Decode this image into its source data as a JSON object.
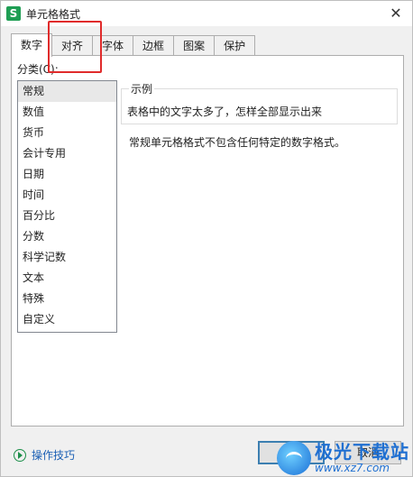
{
  "window": {
    "title": "单元格格式",
    "app_icon": "S"
  },
  "tabs": [
    {
      "label": "数字",
      "active": true
    },
    {
      "label": "对齐",
      "active": false
    },
    {
      "label": "字体",
      "active": false
    },
    {
      "label": "边框",
      "active": false
    },
    {
      "label": "图案",
      "active": false
    },
    {
      "label": "保护",
      "active": false
    }
  ],
  "category": {
    "label": "分类(C):",
    "selected": "常规",
    "items": [
      "常规",
      "数值",
      "货币",
      "会计专用",
      "日期",
      "时间",
      "百分比",
      "分数",
      "科学记数",
      "文本",
      "特殊",
      "自定义"
    ]
  },
  "sample": {
    "title": "示例",
    "text": "表格中的文字太多了，怎样全部显示出来"
  },
  "description": "常规单元格格式不包含任何特定的数字格式。",
  "footer": {
    "tips_label": "操作技巧",
    "ok_label": "确定",
    "cancel_label": "取消"
  },
  "watermark": {
    "title": "极光下载站",
    "url": "www.xz7.com"
  },
  "colors": {
    "accent": "#3c7fb1",
    "highlight": "#e02b2b",
    "link": "#1a5fb4",
    "app": "#1f9e54"
  }
}
